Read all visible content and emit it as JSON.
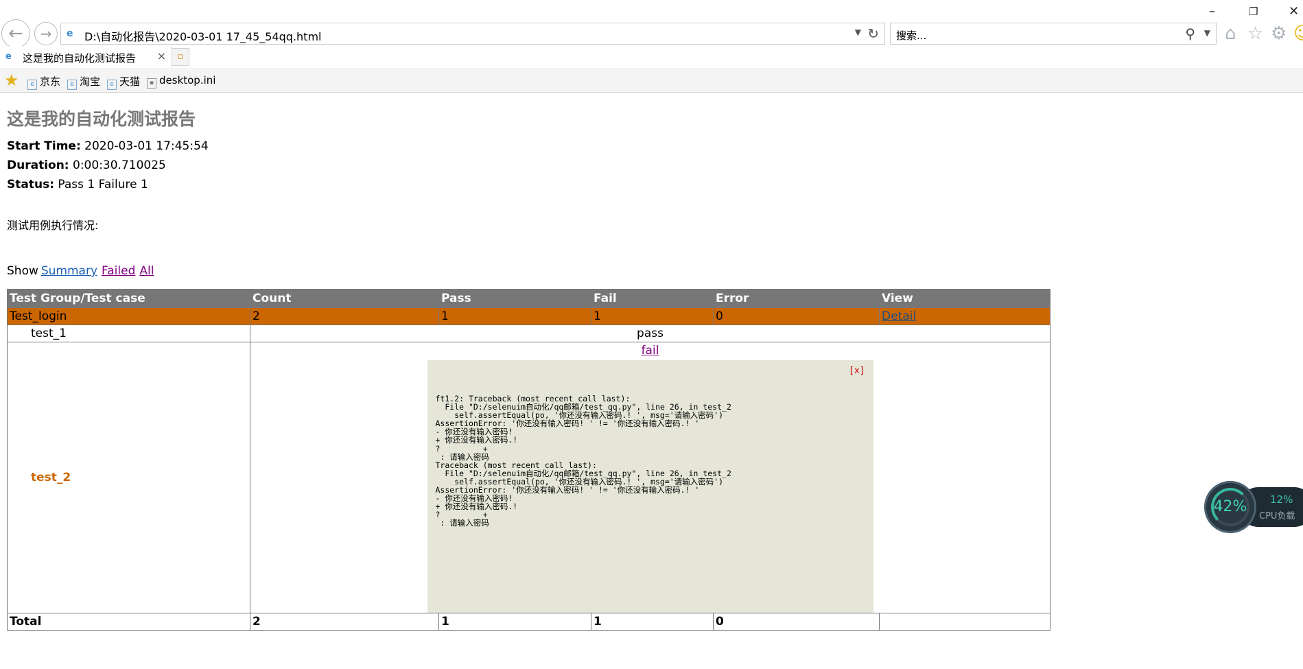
{
  "browser": {
    "url": "D:\\自动化报告\\2020-03-01 17_45_54qq.html",
    "search_placeholder": "搜索...",
    "tab_title": "这是我的自动化测试报告",
    "favorites": [
      "京东",
      "淘宝",
      "天猫",
      "desktop.ini"
    ]
  },
  "report": {
    "heading": "这是我的自动化测试报告",
    "start_time_label": "Start Time:",
    "start_time": "2020-03-01 17:45:54",
    "duration_label": "Duration:",
    "duration": "0:00:30.710025",
    "status_label": "Status:",
    "status": "Pass 1 Failure 1",
    "description": "测试用例执行情况:",
    "show_label": "Show",
    "filters": [
      "Summary",
      "Failed",
      "All"
    ]
  },
  "table": {
    "headers": [
      "Test Group/Test case",
      "Count",
      "Pass",
      "Fail",
      "Error",
      "View"
    ],
    "group": {
      "name": "Test_login",
      "count": "2",
      "pass": "1",
      "fail": "1",
      "error": "0",
      "view": "Detail"
    },
    "case1": {
      "name": "test_1",
      "result": "pass"
    },
    "case2": {
      "name": "test_2",
      "result": "fail",
      "close": "[x]",
      "traceback": "ft1.2: Traceback (most recent call last):\n  File \"D:/selenuim自动化/qq邮箱/test_qq.py\", line 26, in test_2\n    self.assertEqual(po, '你还没有输入密码.! ', msg='请输入密码')\nAssertionError: '你还没有输入密码! ' != '你还没有输入密码.! '\n- 你还没有输入密码!\n+ 你还没有输入密码.!\n?         +\n : 请输入密码\nTraceback (most recent call last):\n  File \"D:/selenuim自动化/qq邮箱/test_qq.py\", line 26, in test_2\n    self.assertEqual(po, '你还没有输入密码.! ', msg='请输入密码')\nAssertionError: '你还没有输入密码! ' != '你还没有输入密码.! '\n- 你还没有输入密码!\n+ 你还没有输入密码.!\n?         +\n : 请输入密码"
    },
    "total": {
      "label": "Total",
      "count": "2",
      "pass": "1",
      "fail": "1",
      "error": "0"
    }
  },
  "cpu_widget": {
    "memory_percent": "42%",
    "cpu_percent": "12%",
    "cpu_label": "CPU负载"
  }
}
